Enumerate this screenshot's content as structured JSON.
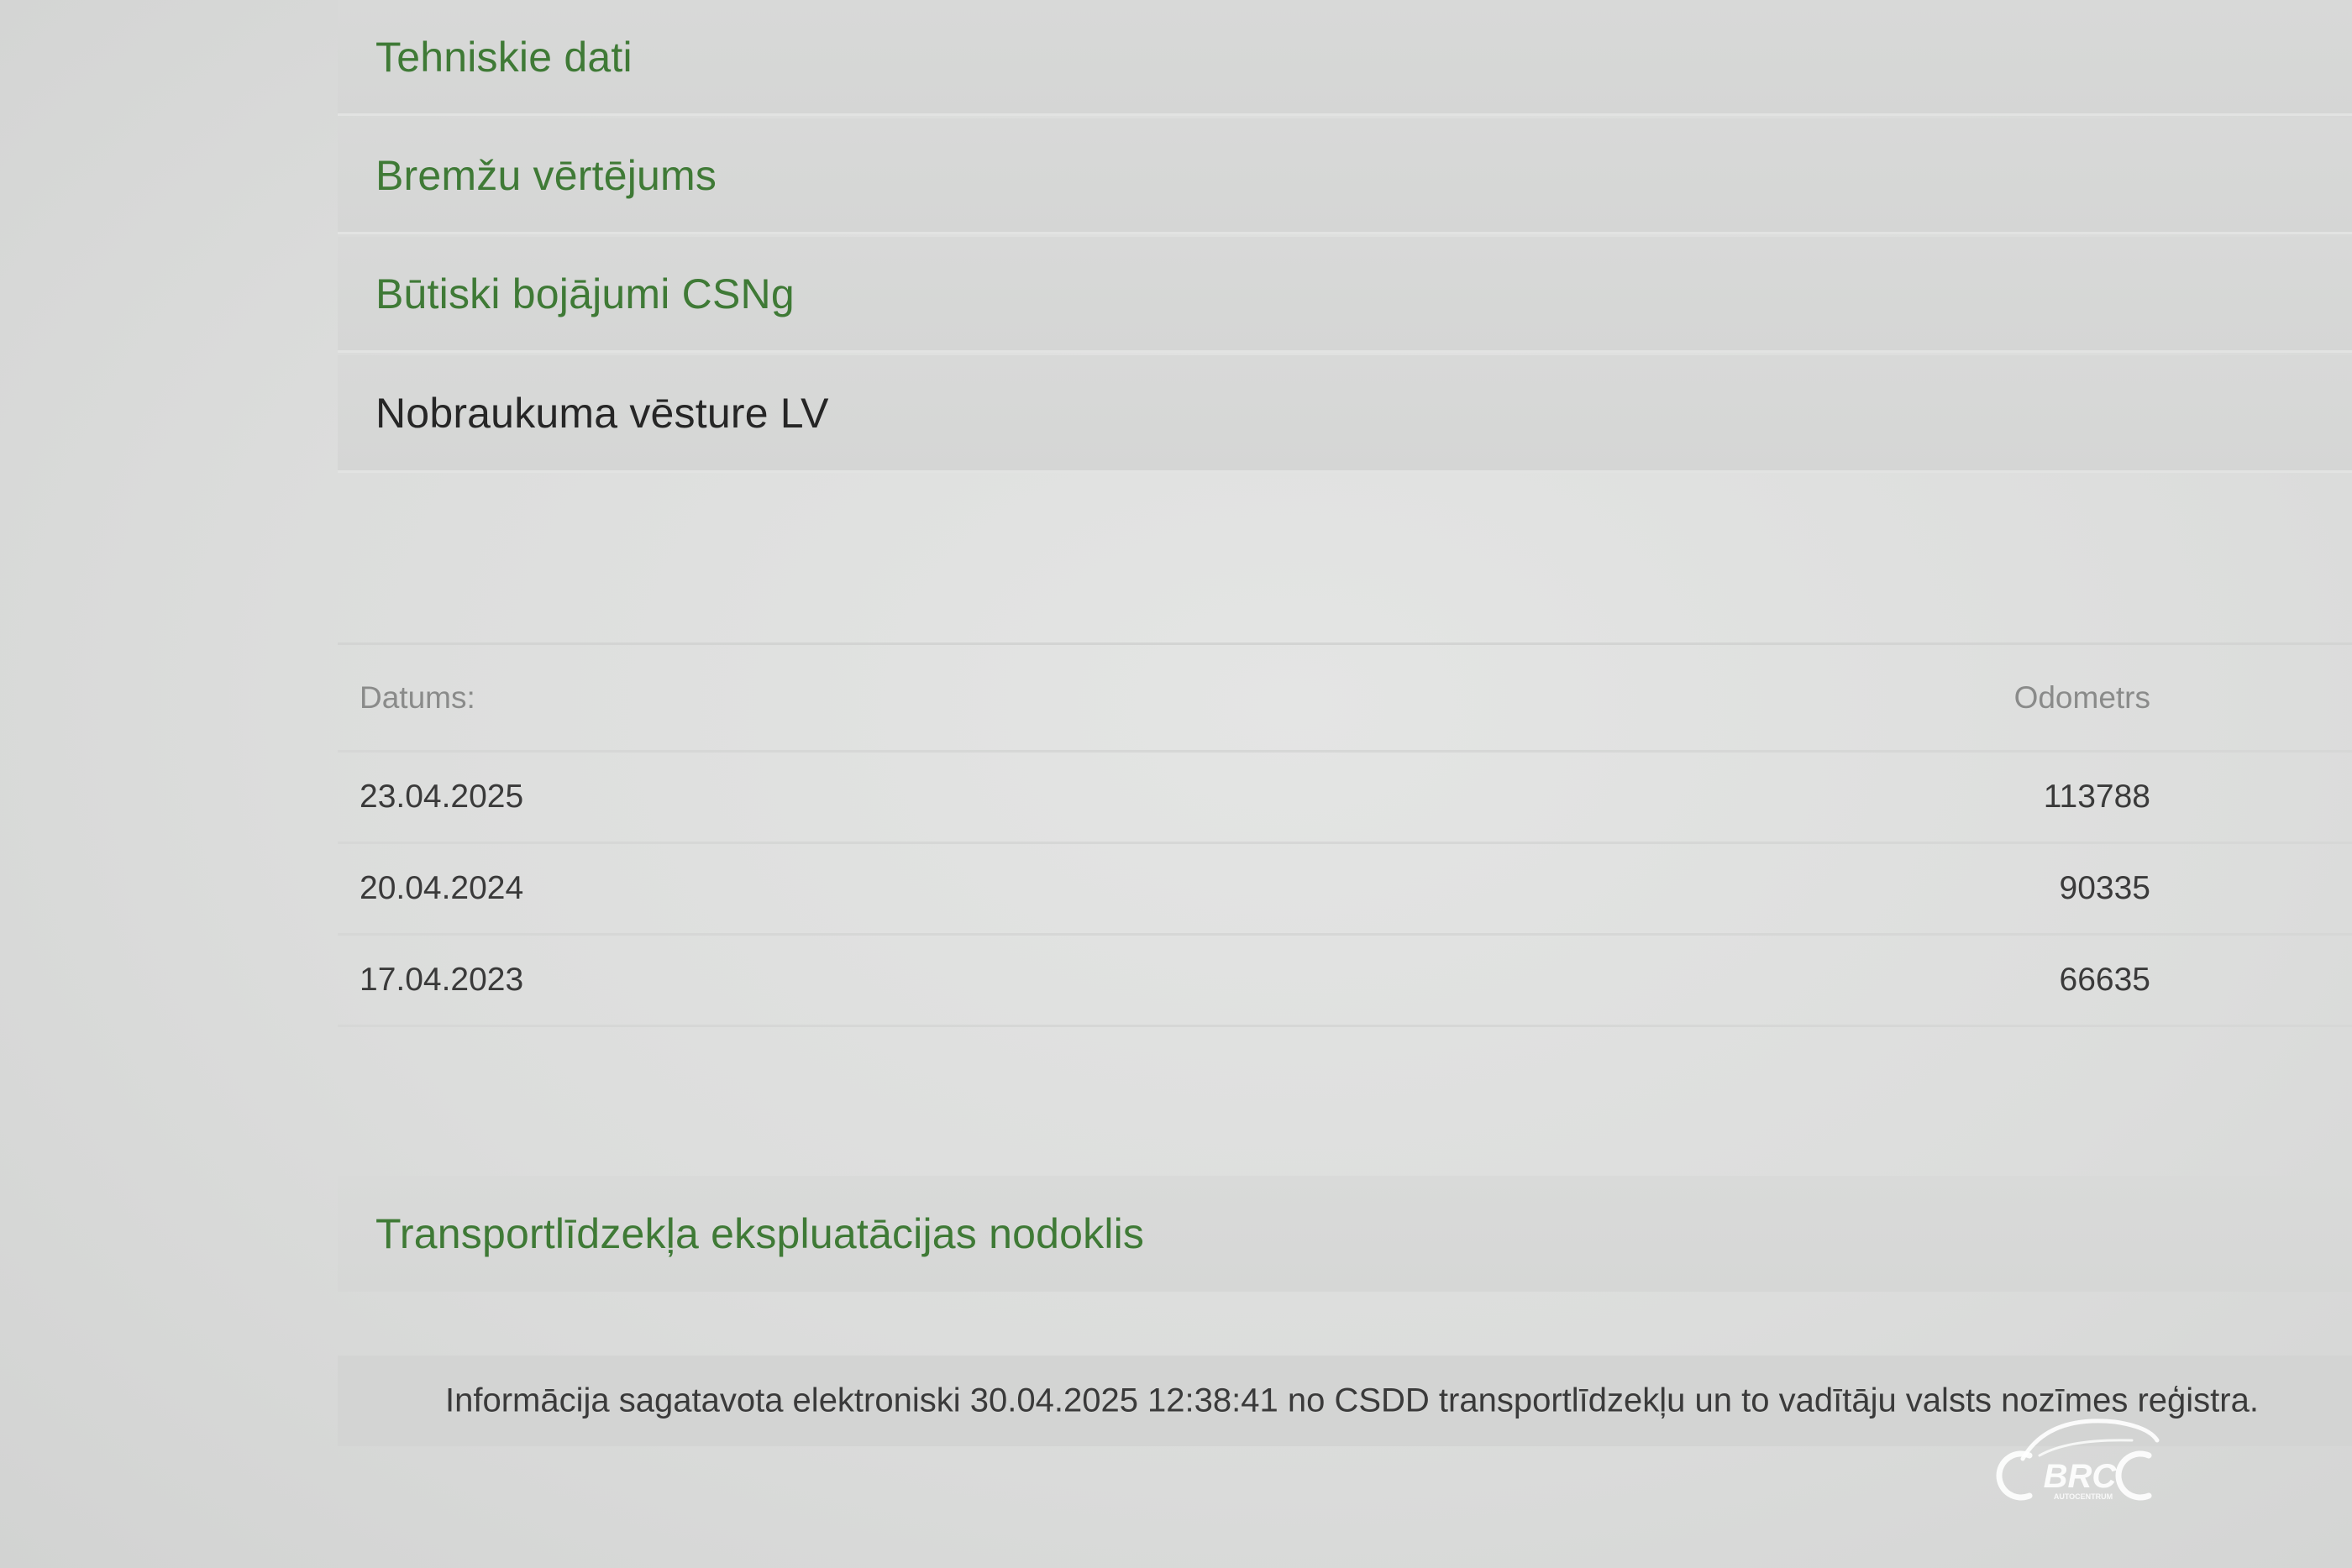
{
  "sections": {
    "technical_data": "Tehniskie dati",
    "brake_assessment": "Bremžu vērtējums",
    "major_damage": "Būtiski bojājumi CSNg",
    "mileage_history": "Nobraukuma vēsture LV",
    "vehicle_tax": "Transportlīdzekļa ekspluatācijas nodoklis"
  },
  "mileage_table": {
    "columns": {
      "date": "Datums:",
      "odometer": "Odometrs"
    },
    "rows": [
      {
        "date": "23.04.2025",
        "odometer": "113788"
      },
      {
        "date": "20.04.2024",
        "odometer": "90335"
      },
      {
        "date": "17.04.2023",
        "odometer": "66635"
      }
    ]
  },
  "footer": {
    "info": "Informācija sagatavota elektroniski 30.04.2025 12:38:41 no CSDD transportlīdzekļu un to vadītāju valsts nozīmes reģistra."
  },
  "watermark": {
    "brand": "BRC",
    "sub": "AUTOCENTRUM"
  },
  "colors": {
    "link_green": "#3f7a36",
    "active_text": "#262626",
    "background": "#dcdddc"
  }
}
